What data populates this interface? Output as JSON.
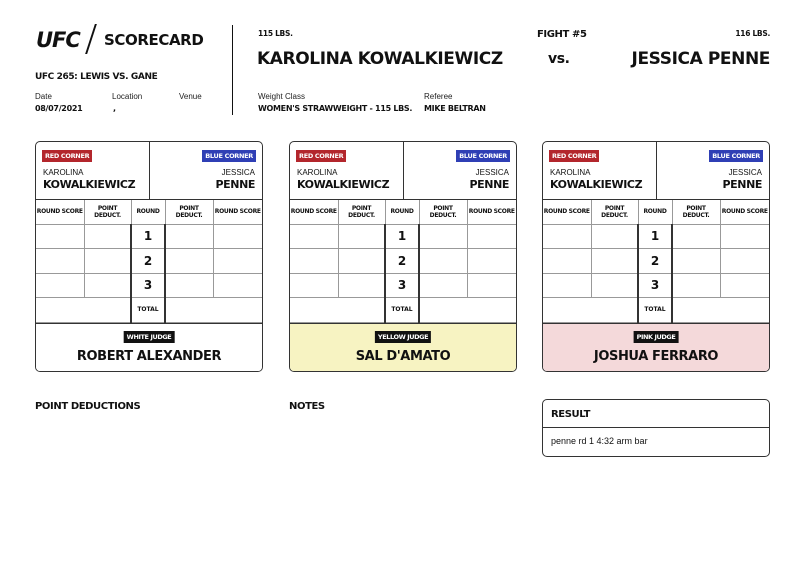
{
  "header": {
    "logo": "UFC",
    "subtitle": "SCORECARD",
    "event": "UFC 265: LEWIS VS. GANE",
    "date_label": "Date",
    "date": "08/07/2021",
    "location_label": "Location",
    "location": ",",
    "venue_label": "Venue",
    "venue": ""
  },
  "fight": {
    "red_weight": "115 LBS.",
    "red_name": "KAROLINA KOWALKIEWICZ",
    "fight_number": "FIGHT #5",
    "vs": "vs.",
    "blue_weight": "116 LBS.",
    "blue_name": "JESSICA PENNE",
    "weight_class_label": "Weight Class",
    "weight_class": "WOMEN'S STRAWWEIGHT - 115 LBS.",
    "referee_label": "Referee",
    "referee": "MIKE BELTRAN"
  },
  "card_labels": {
    "red_corner": "RED CORNER",
    "blue_corner": "BLUE CORNER",
    "red_first": "KAROLINA",
    "red_last": "KOWALKIEWICZ",
    "blue_first": "JESSICA",
    "blue_last": "PENNE",
    "round_score": "ROUND SCORE",
    "point_deduct": "POINT DEDUCT.",
    "round": "ROUND",
    "rounds": [
      "1",
      "2",
      "3"
    ],
    "total": "TOTAL"
  },
  "judges": [
    {
      "badge": "WHITE JUDGE",
      "name": "ROBERT ALEXANDER",
      "color": "#ffffff"
    },
    {
      "badge": "YELLOW JUDGE",
      "name": "SAL D'AMATO",
      "color": "#f7f3c2"
    },
    {
      "badge": "PINK JUDGE",
      "name": "JOSHUA FERRARO",
      "color": "#f4d9da"
    }
  ],
  "sections": {
    "point_deductions": "POINT DEDUCTIONS",
    "notes": "NOTES",
    "result_title": "RESULT",
    "result_text": "penne rd 1 4:32 arm bar"
  },
  "colors": {
    "red_corner": "#b3262c",
    "blue_corner": "#2f3fb5"
  }
}
